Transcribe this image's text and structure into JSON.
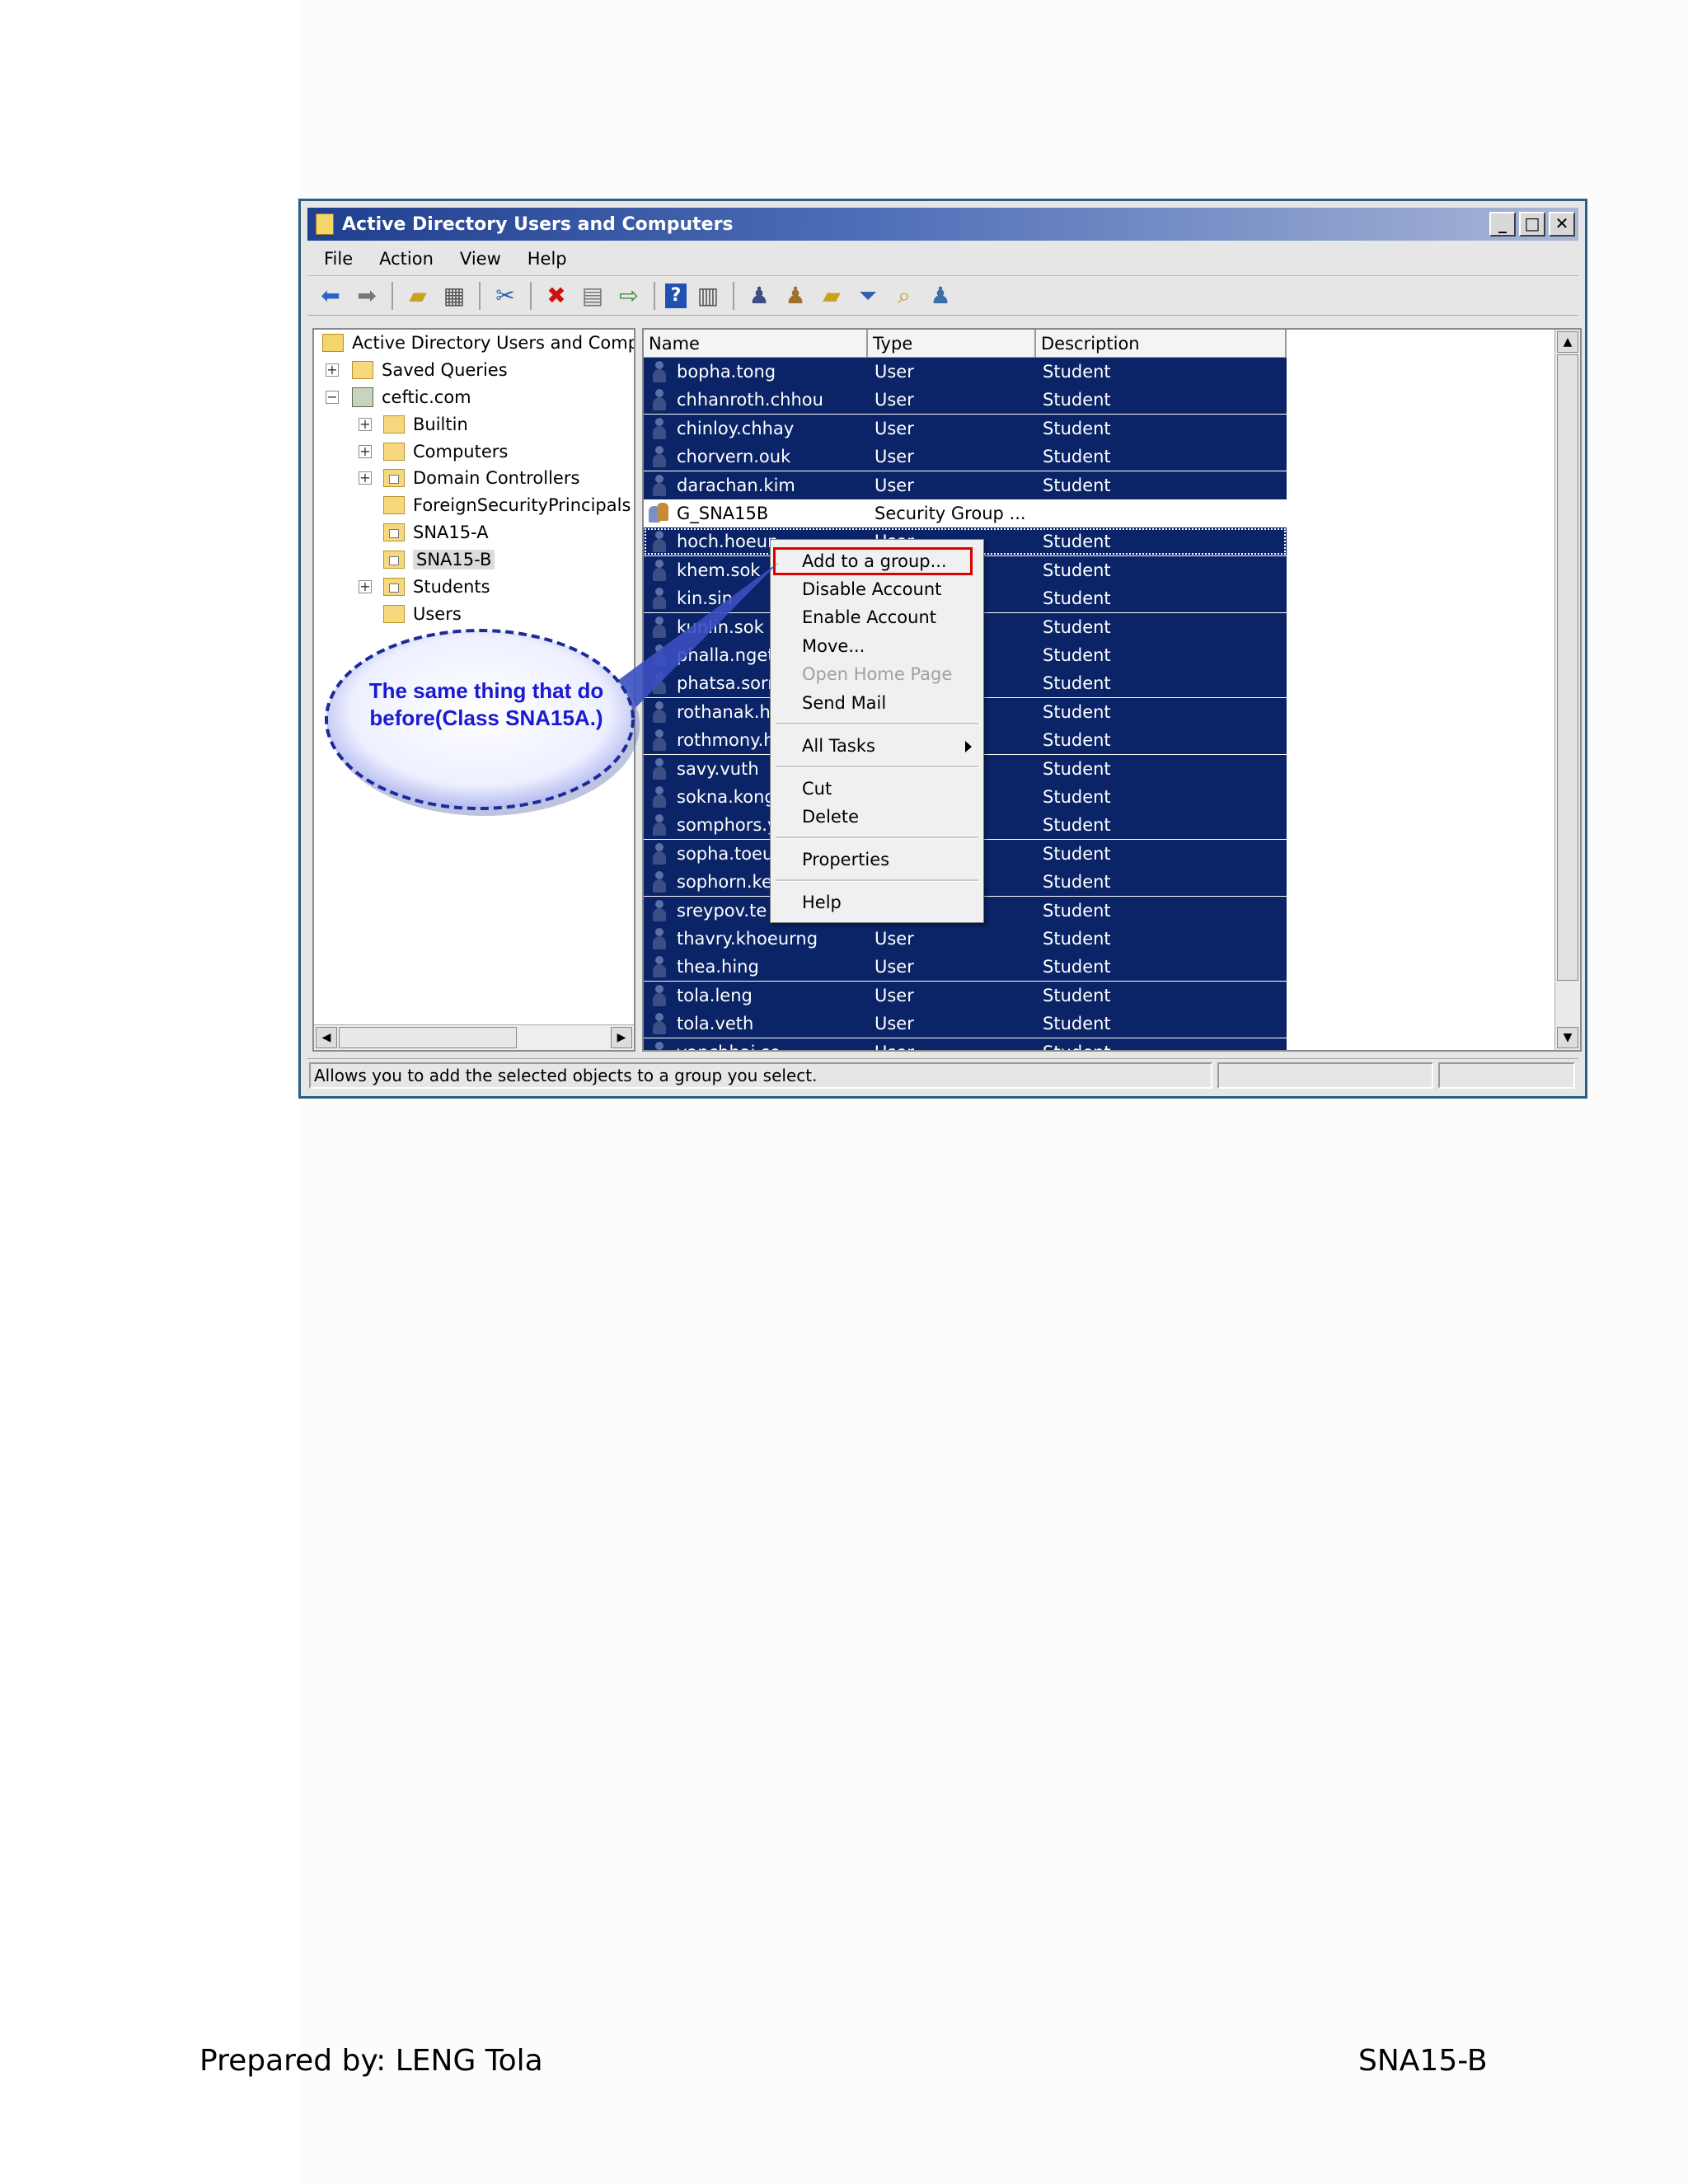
{
  "window": {
    "title": "Active Directory Users and Computers",
    "controls": [
      "minimize-icon",
      "maximize-icon",
      "close-icon"
    ]
  },
  "menu": [
    "File",
    "Action",
    "View",
    "Help"
  ],
  "toolbar_icons": [
    "back-arrow-icon",
    "forward-arrow-icon",
    "up-folder-icon",
    "show-console-tree-icon",
    "cut-icon",
    "delete-icon",
    "properties-icon",
    "export-list-icon",
    "help-icon",
    "show-hide-action-pane-icon",
    "new-user-icon",
    "new-group-icon",
    "new-ou-icon",
    "filter-icon",
    "find-icon",
    "add-to-group-icon"
  ],
  "tree": {
    "root": "Active Directory Users and Comput",
    "items": [
      {
        "label": "Saved Queries",
        "expander": "+",
        "type": "folder"
      },
      {
        "label": "ceftic.com",
        "expander": "−",
        "type": "domain"
      },
      {
        "label": "Builtin",
        "expander": "+",
        "type": "folder"
      },
      {
        "label": "Computers",
        "expander": "+",
        "type": "folder"
      },
      {
        "label": "Domain Controllers",
        "expander": "+",
        "type": "ou"
      },
      {
        "label": "ForeignSecurityPrincipals",
        "expander": "",
        "type": "folder"
      },
      {
        "label": "SNA15-A",
        "expander": "",
        "type": "ou"
      },
      {
        "label": "SNA15-B",
        "expander": "",
        "type": "ou",
        "selected": true
      },
      {
        "label": "Students",
        "expander": "+",
        "type": "ou"
      },
      {
        "label": "Users",
        "expander": "",
        "type": "folder"
      }
    ]
  },
  "list": {
    "columns": [
      "Name",
      "Type",
      "Description"
    ],
    "rows": [
      {
        "name": "bopha.tong",
        "type": "User",
        "description": "Student"
      },
      {
        "name": "chhanroth.chhou",
        "type": "User",
        "description": "Student"
      },
      {
        "name": "chinloy.chhay",
        "type": "User",
        "description": "Student"
      },
      {
        "name": "chorvern.ouk",
        "type": "User",
        "description": "Student"
      },
      {
        "name": "darachan.kim",
        "type": "User",
        "description": "Student"
      },
      {
        "name": "G_SNA15B",
        "type": "Security Group ...",
        "description": "",
        "group": true
      },
      {
        "name": "hoch.hoeun",
        "type": "User",
        "description": "Student"
      },
      {
        "name": "khem.sok",
        "type": "",
        "description": "Student"
      },
      {
        "name": "kin.sin",
        "type": "",
        "description": "Student"
      },
      {
        "name": "kunlin.sok",
        "type": "",
        "description": "Student"
      },
      {
        "name": "phalla.nget",
        "type": "",
        "description": "Student"
      },
      {
        "name": "phatsa.sorn",
        "type": "",
        "description": "Student"
      },
      {
        "name": "rothanak.h",
        "type": "",
        "description": "Student"
      },
      {
        "name": "rothmony.h",
        "type": "",
        "description": "Student"
      },
      {
        "name": "savy.vuth",
        "type": "",
        "description": "Student"
      },
      {
        "name": "sokna.kong",
        "type": "",
        "description": "Student"
      },
      {
        "name": "somphors.y",
        "type": "",
        "description": "Student"
      },
      {
        "name": "sopha.toeu",
        "type": "",
        "description": "Student"
      },
      {
        "name": "sophorn.ke",
        "type": "",
        "description": "Student"
      },
      {
        "name": "sreypov.te",
        "type": "",
        "description": "Student"
      },
      {
        "name": "thavry.khoeurng",
        "type": "User",
        "description": "Student"
      },
      {
        "name": "thea.hing",
        "type": "User",
        "description": "Student"
      },
      {
        "name": "tola.leng",
        "type": "User",
        "description": "Student"
      },
      {
        "name": "tola.veth",
        "type": "User",
        "description": "Student"
      },
      {
        "name": "vanchhai.so",
        "type": "User",
        "description": "Student"
      }
    ]
  },
  "context_menu": {
    "items": [
      "Add to a group...",
      "Disable Account",
      "Enable Account",
      "Move...",
      "Open Home Page",
      "Send Mail",
      "All Tasks",
      "Cut",
      "Delete",
      "Properties",
      "Help"
    ],
    "disabled": [
      "Open Home Page"
    ],
    "highlighted": "Add to a group...",
    "has_submenu": [
      "All Tasks"
    ]
  },
  "status": {
    "message": "Allows you to add the selected objects to a group you select."
  },
  "callout": {
    "text": "The same thing that do before(Class SNA15A.)"
  },
  "footer": {
    "left": "Prepared by: LENG Tola",
    "right": "SNA15-B"
  },
  "colors": {
    "selection": "#0a2467",
    "callout_text": "#1a1ad0",
    "highlight_box": "#dd0000"
  }
}
